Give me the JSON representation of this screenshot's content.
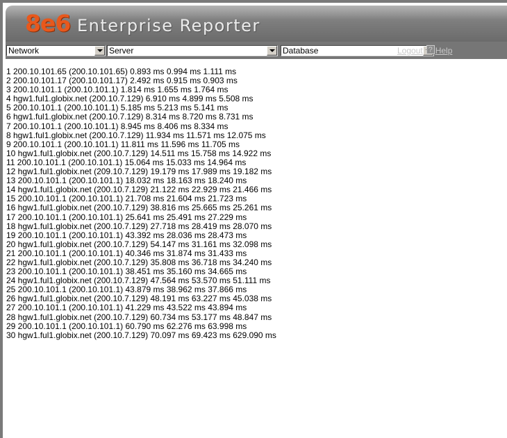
{
  "app": {
    "logo": "8e6",
    "title": "Enterprise Reporter"
  },
  "nav": {
    "network_select": "Network",
    "server_select": "Server",
    "database_select": "Database",
    "logout_label": "Logout",
    "help_icon_label": "?",
    "help_label": "Help"
  },
  "trace_lines": [
    "1 200.10.101.65 (200.10.101.65) 0.893 ms 0.994 ms 1.111 ms",
    "2 200.10.101.17 (200.10.101.17) 2.492 ms 0.915 ms 0.903 ms",
    "3 200.10.101.1 (200.10.101.1) 1.814 ms 1.655 ms 1.764 ms",
    "4 hgw1.ful1.globix.net (200.10.7.129) 6.910 ms 4.899 ms 5.508 ms",
    "5 200.10.101.1 (200.10.101.1) 5.185 ms 5.213 ms 5.141 ms",
    "6 hgw1.ful1.globix.net (200.10.7.129) 8.314 ms 8.720 ms 8.731 ms",
    "7 200.10.101.1 (200.10.101.1) 8.945 ms 8.406 ms 8.334 ms",
    "8 hgw1.ful1.globix.net (200.10.7.129) 11.934 ms 11.571 ms 12.075 ms",
    "9 200.10.101.1 (200.10.101.1) 11.811 ms 11.596 ms 11.705 ms",
    "10 hgw1.ful1.globix.net (200.10.7.129) 14.511 ms 15.758 ms 14.922 ms",
    "11 200.10.101.1 (200.10.101.1) 15.064 ms 15.033 ms 14.964 ms",
    "12 hgw1.ful1.globix.net (209.10.7.129) 19.179 ms 17.989 ms 19.182 ms",
    "13 200.10.101.1 (200.10.101.1) 18.032 ms 18.163 ms 18.240 ms",
    "14 hgw1.ful1.globix.net (200.10.7.129) 21.122 ms 22.929 ms 21.466 ms",
    "15 200.10.101.1 (200.10.101.1) 21.708 ms 21.604 ms 21.723 ms",
    "16 hgw1.ful1.globix.net (200.10.7.129) 38.816 ms 25.665 ms 25.261 ms",
    "17 200.10.101.1 (200.10.101.1) 25.641 ms 25.491 ms 27.229 ms",
    "18 hgw1.ful1.globix.net (200.10.7.129) 27.718 ms 28.419 ms 28.070 ms",
    "19 200.10.101.1 (200.10.101.1) 43.392 ms 28.036 ms 28.473 ms",
    "20 hgw1.ful1.globix.net (200.10.7.129) 54.147 ms 31.161 ms 32.098 ms",
    "21 200.10.101.1 (200.10.101.1) 40.346 ms 31.874 ms 31.433 ms",
    "22 hgw1.ful1.globix.net (200.10.7.129) 35.808 ms 36.718 ms 34.240 ms",
    "23 200.10.101.1 (200.10.101.1) 38.451 ms 35.160 ms 34.665 ms",
    "24 hgw1.ful1.globix.net (200.10.7.129) 47.564 ms 53.570 ms 51.111 ms",
    "25 200.10.101.1 (200.10.101.1) 43.879 ms 38.962 ms 37.866 ms",
    "26 hgw1.ful1.globix.net (200.10.7.129) 48.191 ms 63.227 ms 45.038 ms",
    "27 200.10.101.1 (200.10.101.1) 41.229 ms 43.522 ms 43.894 ms",
    "28 hgw1.ful1.globix.net (200.10.7.129) 60.734 ms 53.177 ms 48.847 ms",
    "29 200.10.101.1 (200.10.101.1) 60.790 ms 62.276 ms 63.998 ms",
    "30 hgw1.ful1.globix.net (200.10.7.129) 70.097 ms 69.423 ms 629.090 ms"
  ],
  "colors": {
    "logo": "#e8581c",
    "banner": "#7d7d7d",
    "navbar": "#767676",
    "link": "#c9c9c9"
  }
}
